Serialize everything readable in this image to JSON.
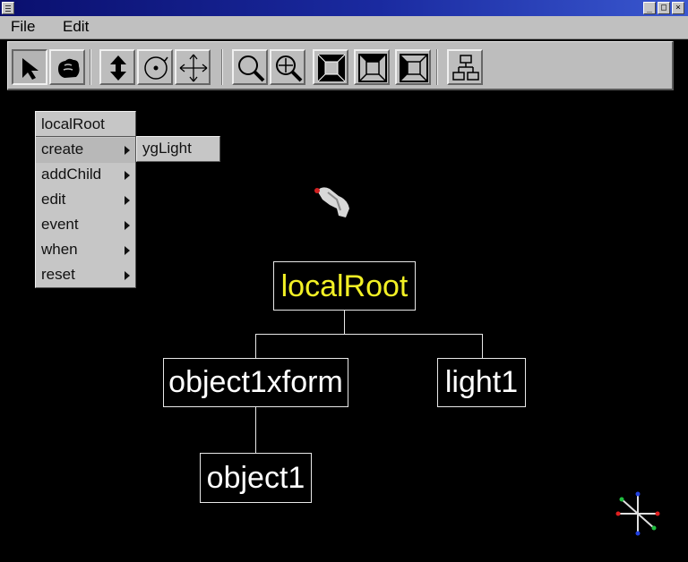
{
  "menubar": {
    "file": "File",
    "edit": "Edit"
  },
  "toolbar": {
    "tools": [
      "select-arrow-icon",
      "grab-hand-icon",
      "translate-updown-icon",
      "rotate-icon",
      "move-cross-icon",
      "zoom-icon",
      "zoom-center-icon",
      "view-front-icon",
      "view-top-icon",
      "view-side-icon",
      "hierarchy-icon"
    ]
  },
  "context_menu": {
    "title": "localRoot",
    "items": [
      {
        "label": "create"
      },
      {
        "label": "addChild"
      },
      {
        "label": "edit"
      },
      {
        "label": "event"
      },
      {
        "label": "when"
      },
      {
        "label": "reset"
      }
    ]
  },
  "submenu": {
    "items": [
      {
        "label": "ygLight"
      }
    ]
  },
  "scene": {
    "nodes": {
      "root": "localRoot",
      "xform": "object1xform",
      "light": "light1",
      "object": "object1"
    }
  },
  "colors": {
    "root_label": "#f2f025",
    "node_label": "#ffffff",
    "title_bar": "#1a2aa0"
  }
}
